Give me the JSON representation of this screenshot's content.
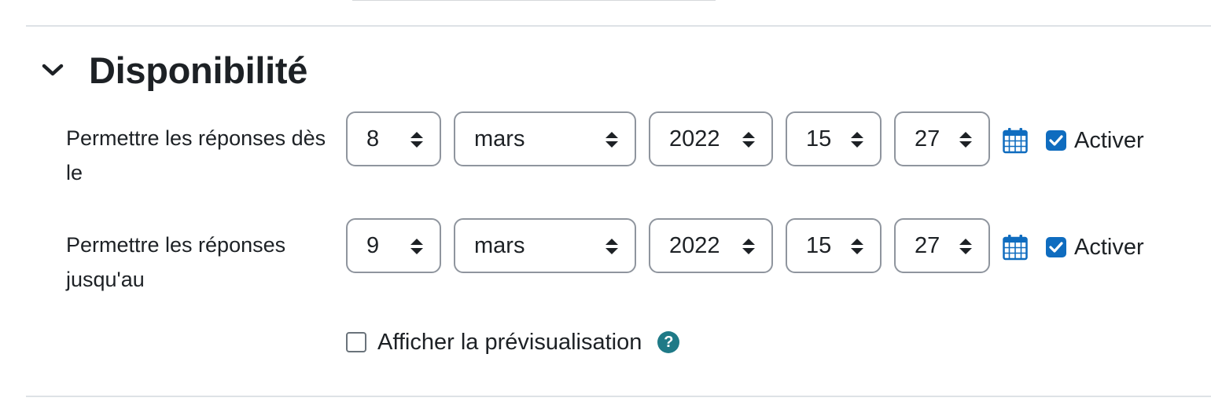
{
  "section": {
    "title": "Disponibilité"
  },
  "rows": [
    {
      "label": "Permettre les réponses dès le",
      "day": "8",
      "month": "mars",
      "year": "2022",
      "hour": "15",
      "minute": "27",
      "enable_label": "Activer",
      "enabled": true
    },
    {
      "label": "Permettre les réponses jusqu'au",
      "day": "9",
      "month": "mars",
      "year": "2022",
      "hour": "15",
      "minute": "27",
      "enable_label": "Activer",
      "enabled": true
    }
  ],
  "preview": {
    "label": "Afficher la prévisualisation",
    "checked": false
  },
  "icons": {
    "section_toggle": "chevron-down-icon",
    "calendar": "calendar-icon",
    "select_arrows": "sort-arrows-icon",
    "help": "question-circle-icon"
  },
  "colors": {
    "accent": "#0f6cbf",
    "help_icon": "#1f7a87",
    "calendar_icon": "#0f6cbf"
  }
}
